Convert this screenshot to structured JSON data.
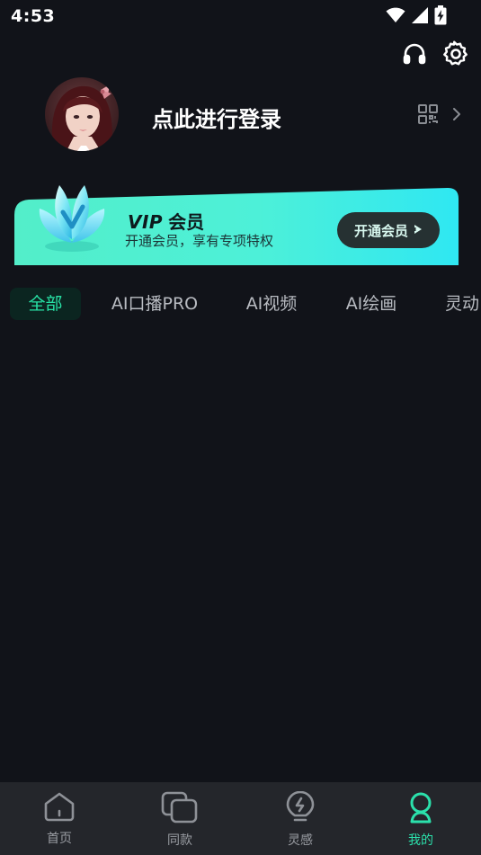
{
  "status_bar": {
    "time": "4:53",
    "icons": [
      "wifi-icon",
      "signal-icon",
      "battery-charging-icon"
    ]
  },
  "header": {
    "icons": [
      "headphones-icon",
      "settings-gear-icon"
    ]
  },
  "profile": {
    "login_text": "点此进行登录",
    "qr_icon": "qr-code-icon",
    "chevron_icon": "chevron-right-icon"
  },
  "vip_banner": {
    "title_vip": "VIP",
    "title_member": "会员",
    "subtitle": "开通会员，享有专项特权",
    "button_label": "开通会员",
    "colors": {
      "gradient_start": "#5af2cf",
      "gradient_end": "#2ee8f0",
      "button_bg": "#263132"
    }
  },
  "tabs": [
    {
      "label": "全部",
      "active": true
    },
    {
      "label": "AI口播PRO",
      "active": false
    },
    {
      "label": "AI视频",
      "active": false
    },
    {
      "label": "AI绘画",
      "active": false
    },
    {
      "label": "灵动",
      "active": false
    }
  ],
  "bottom_nav": [
    {
      "label": "首页",
      "icon": "home-icon",
      "active": false
    },
    {
      "label": "同款",
      "icon": "copy-stack-icon",
      "active": false
    },
    {
      "label": "灵感",
      "icon": "lightbulb-icon",
      "active": false
    },
    {
      "label": "我的",
      "icon": "profile-icon",
      "active": true
    }
  ],
  "colors": {
    "background": "#111319",
    "accent": "#28e3a6",
    "nav_bg": "#24262b"
  }
}
